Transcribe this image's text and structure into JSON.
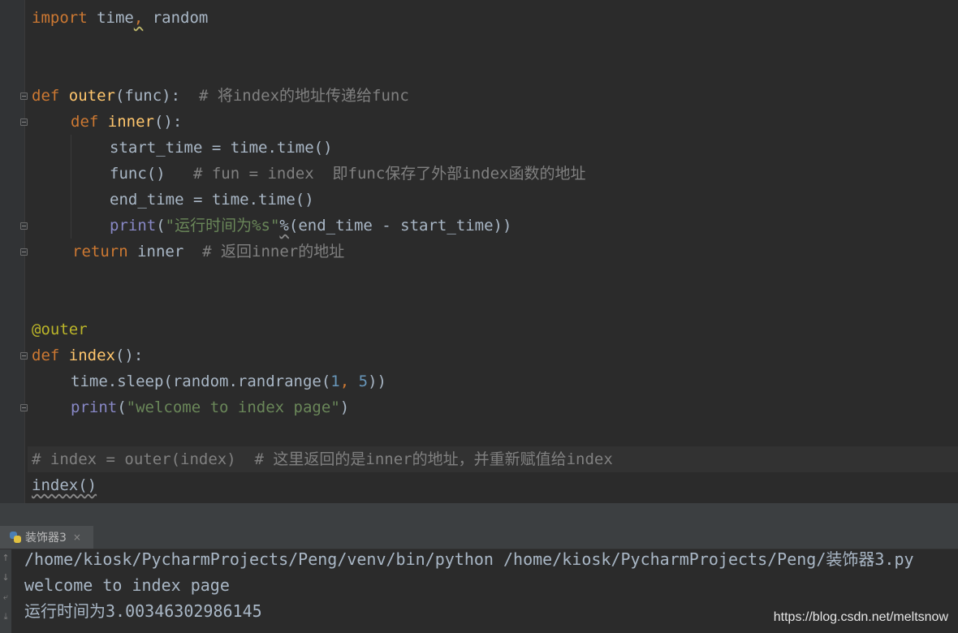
{
  "editor": {
    "lines": {
      "l1": {
        "t1": "import",
        "t2": " time",
        "t3": ",",
        "t4": " random"
      },
      "l4": {
        "t1": "def",
        "t2": " ",
        "t3": "outer",
        "t4": "(func):  ",
        "t5": "# 将index的地址传递给func"
      },
      "l5": {
        "t1": "def",
        "t2": " ",
        "t3": "inner",
        "t4": "():"
      },
      "l6": {
        "t1": "start_time = time.time()"
      },
      "l7": {
        "t1": "func()   ",
        "t2": "# fun = index  即func保存了外部index函数的地址"
      },
      "l8": {
        "t1": "end_time = time.time()"
      },
      "l9": {
        "t1": "print",
        "t2": "(",
        "t3": "\"运行时间为%s\"",
        "t4": "%",
        "t5": "(end_time - start_time))"
      },
      "l10": {
        "t1": "return",
        "t2": " inner  ",
        "t3": "# 返回inner的地址"
      },
      "l13": {
        "t1": "@outer"
      },
      "l14": {
        "t1": "def",
        "t2": " ",
        "t3": "index",
        "t4": "():"
      },
      "l15": {
        "t1": "time.sleep(random.randrange(",
        "t2": "1",
        "t3": ", ",
        "t4": "5",
        "t5": "))"
      },
      "l16": {
        "t1": "print",
        "t2": "(",
        "t3": "\"welcome to index page\"",
        "t4": ")"
      },
      "l18": {
        "t1": "# index = outer(index)  # 这里返回的是inner的地址，并重新赋值给index"
      },
      "l19": {
        "t1": "index()"
      }
    }
  },
  "run_panel": {
    "tab_label": "装饰器3",
    "tab_close": "×",
    "tab_icon": "python-icon",
    "output": [
      "/home/kiosk/PycharmProjects/Peng/venv/bin/python /home/kiosk/PycharmProjects/Peng/装饰器3.py",
      "welcome to index page",
      "运行时间为3.00346302986145"
    ],
    "toolbar_icons": [
      "arrow-up-icon",
      "arrow-down-icon",
      "wrap-icon",
      "scroll-to-end-icon"
    ]
  },
  "watermark": "https://blog.csdn.net/meltsnow",
  "colors": {
    "background": "#2b2b2b",
    "keyword": "#cc7832",
    "function": "#ffc66d",
    "string": "#6a8759",
    "comment": "#808080",
    "builtin": "#8888c6",
    "number": "#6897bb",
    "decorator": "#bbb529"
  }
}
